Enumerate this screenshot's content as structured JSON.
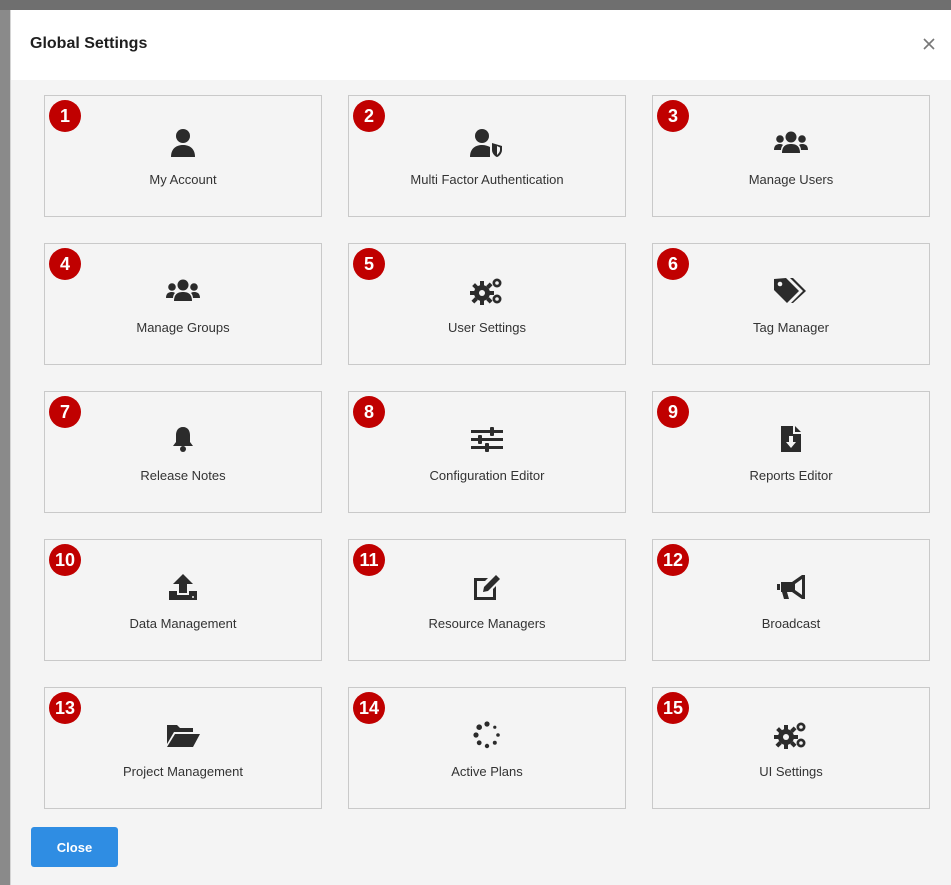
{
  "dialog": {
    "title": "Global Settings",
    "close_button_label": "Close"
  },
  "tiles": [
    {
      "number": "1",
      "label": "My Account",
      "icon": "user-icon"
    },
    {
      "number": "2",
      "label": "Multi Factor Authentication",
      "icon": "user-shield-icon"
    },
    {
      "number": "3",
      "label": "Manage Users",
      "icon": "users-icon"
    },
    {
      "number": "4",
      "label": "Manage Groups",
      "icon": "users-icon"
    },
    {
      "number": "5",
      "label": "User Settings",
      "icon": "cogs-icon"
    },
    {
      "number": "6",
      "label": "Tag Manager",
      "icon": "tags-icon"
    },
    {
      "number": "7",
      "label": "Release Notes",
      "icon": "bell-icon"
    },
    {
      "number": "8",
      "label": "Configuration Editor",
      "icon": "sliders-icon"
    },
    {
      "number": "9",
      "label": "Reports Editor",
      "icon": "file-download-icon"
    },
    {
      "number": "10",
      "label": "Data Management",
      "icon": "upload-icon"
    },
    {
      "number": "11",
      "label": "Resource Managers",
      "icon": "edit-icon"
    },
    {
      "number": "12",
      "label": "Broadcast",
      "icon": "bullhorn-icon"
    },
    {
      "number": "13",
      "label": "Project Management",
      "icon": "folder-open-icon"
    },
    {
      "number": "14",
      "label": "Active Plans",
      "icon": "spinner-icon"
    },
    {
      "number": "15",
      "label": "UI Settings",
      "icon": "cogs-icon"
    }
  ],
  "colors": {
    "badge": "#c00000",
    "primary_button": "#2f8de3",
    "icon": "#2b2b2b"
  }
}
